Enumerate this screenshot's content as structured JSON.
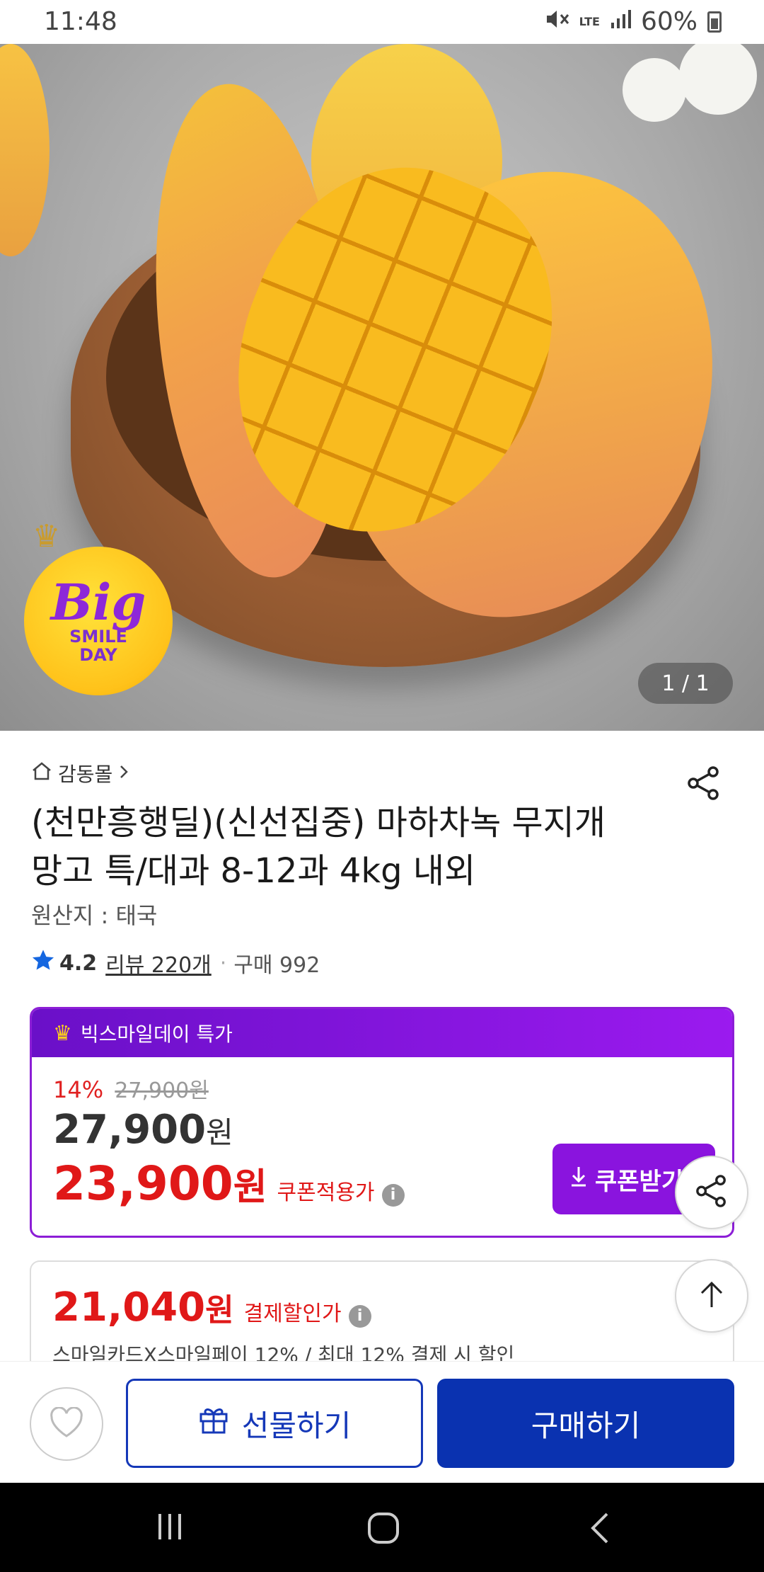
{
  "status_bar": {
    "time": "11:48",
    "network": "LTE",
    "battery": "60%"
  },
  "hero": {
    "badge_big": "Big",
    "badge_line1": "SMILE",
    "badge_line2": "DAY",
    "counter": "1 / 1"
  },
  "product": {
    "store": "감동몰",
    "title_line1": "(천만흥행딜)(신선집중) 마하차녹 무지개",
    "title_line2": "망고 특/대과 8-12과 4kg 내외",
    "origin": "원산지 : 태국",
    "rating": "4.2",
    "reviews": "리뷰 220개",
    "separator": "·",
    "purchases": "구매 992"
  },
  "promo": {
    "header": "빅스마일데이 특가",
    "discount_pct": "14%",
    "original_price": "27,900원",
    "normal_price_num": "27,900",
    "normal_price_won": "원",
    "coupon_price_num": "23,900",
    "coupon_price_won": "원",
    "coupon_label": "쿠폰적용가",
    "coupon_button": "쿠폰받기"
  },
  "payment": {
    "price_num": "21,040",
    "price_won": "원",
    "label": "결제할인가",
    "description": "스마일카드X스마일페이 12% / 최대 12% 결제 시 할인"
  },
  "actions": {
    "gift": "선물하기",
    "buy": "구매하기"
  },
  "colors": {
    "accent_purple": "#8a14de",
    "sale_red": "#e01818",
    "buy_blue": "#0a32b0"
  }
}
